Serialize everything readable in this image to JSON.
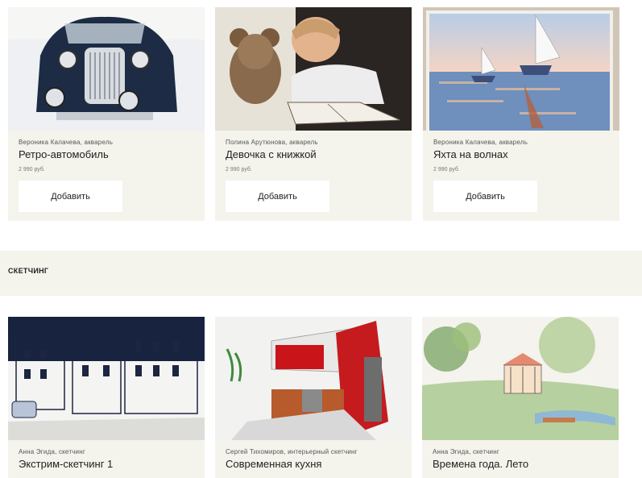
{
  "row1": [
    {
      "author": "Вероника Калачева, акварель",
      "title": "Ретро-автомобиль",
      "price": "2 990 руб.",
      "button": "Добавить",
      "image": "retro-car-watercolor"
    },
    {
      "author": "Полина Арутюнова, акварель",
      "title": "Девочка с книжкой",
      "price": "2 990 руб.",
      "button": "Добавить",
      "image": "girl-with-book-watercolor"
    },
    {
      "author": "Вероника Калачева, акварель",
      "title": "Яхта на волнах",
      "price": "2 990 руб.",
      "button": "Добавить",
      "image": "yacht-watercolor"
    }
  ],
  "section": {
    "title": "СКЕТЧИНГ"
  },
  "row2": [
    {
      "author": "Анна Эгида, скетчинг",
      "title": "Экстрим-скетчинг 1",
      "image": "city-street-sketch"
    },
    {
      "author": "Сергей Тихомиров, интерьерный скетчинг",
      "title": "Современная кухня",
      "image": "modern-kitchen-sketch"
    },
    {
      "author": "Анна Эгида, скетчинг",
      "title": "Времена года. Лето",
      "image": "summer-park-sketch"
    }
  ]
}
